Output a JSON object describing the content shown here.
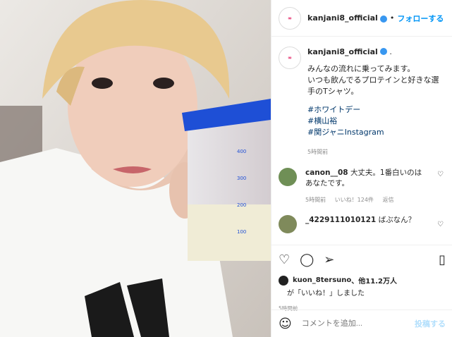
{
  "header": {
    "username": "kanjani8_official",
    "dot": "•",
    "follow_label": "フォローする"
  },
  "caption": {
    "username": "kanjani8_official",
    "after_verified": ".",
    "lines": [
      "みんなの流れに乗ってみます。",
      "いつも飲んでるプロテインと好きな選",
      "手のTシャツ。"
    ],
    "hashtags": [
      "#ホワイトデー",
      "#横山裕",
      "#関ジャニInstagram"
    ],
    "time": "5時間前"
  },
  "comments": [
    {
      "username": "canon__08",
      "text": "大丈夫。1番白いのは",
      "text2": "あなたです。",
      "time": "5時間前",
      "likes": "いいね！124件",
      "reply": "返信"
    },
    {
      "username": "_4229111010121",
      "text": "ばぶなん？"
    }
  ],
  "actions": {
    "likes_prefix": "kuon_8tersuno",
    "likes_suffix": "、他11.2万人",
    "likes_line2": "が「いいね！」しました",
    "time": "5時間前"
  },
  "comment_box": {
    "placeholder": "コメントを追加...",
    "post_label": "投稿する"
  },
  "photo": {
    "cup_marks": [
      "400",
      "300",
      "200",
      "100"
    ]
  }
}
